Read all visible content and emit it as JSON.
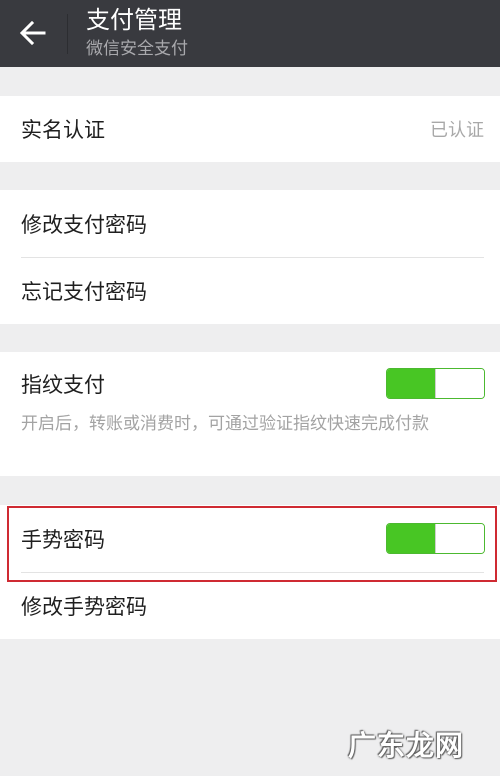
{
  "header": {
    "title": "支付管理",
    "subtitle": "微信安全支付",
    "back_icon": "arrow-left-icon"
  },
  "realname": {
    "label": "实名认证",
    "value": "已认证"
  },
  "password": {
    "change_label": "修改支付密码",
    "forgot_label": "忘记支付密码"
  },
  "fingerprint": {
    "label": "指纹支付",
    "enabled": true,
    "description": "开启后，转账或消费时，可通过验证指纹快速完成付款"
  },
  "gesture": {
    "label": "手势密码",
    "enabled": true,
    "change_label": "修改手势密码"
  },
  "colors": {
    "header_bg": "#393a3f",
    "switch_on": "#48c624",
    "highlight": "#cf2a32",
    "page_bg": "#eeeeef"
  },
  "watermark": "广东龙网"
}
